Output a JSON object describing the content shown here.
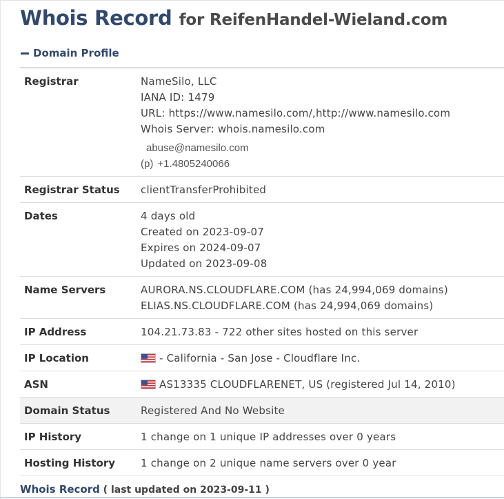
{
  "header": {
    "title_main": "Whois Record",
    "title_sub": "for ReifenHandel-Wieland.com"
  },
  "section": {
    "title": "Domain Profile",
    "icon": "minus-icon"
  },
  "registrar": {
    "label": "Registrar",
    "name": "NameSilo, LLC",
    "iana": "IANA ID: 1479",
    "url": "URL: https://www.namesilo.com/,http://www.namesilo.com",
    "whois_server": "Whois Server: whois.namesilo.com",
    "email": "abuse@namesilo.com",
    "phone_prefix": "(p)",
    "phone": "+1.4805240066"
  },
  "registrar_status": {
    "label": "Registrar Status",
    "value": "clientTransferProhibited"
  },
  "dates": {
    "label": "Dates",
    "age": "4 days old",
    "created": "Created on 2023-09-07",
    "expires": "Expires on 2024-09-07",
    "updated": "Updated on 2023-09-08"
  },
  "name_servers": {
    "label": "Name Servers",
    "ns1": "AURORA.NS.CLOUDFLARE.COM (has 24,994,069 domains)",
    "ns2": "ELIAS.NS.CLOUDFLARE.COM (has 24,994,069 domains)"
  },
  "ip_address": {
    "label": "IP Address",
    "value": "104.21.73.83 - 722 other sites hosted on this server"
  },
  "ip_location": {
    "label": "IP Location",
    "value": "- California - San Jose - Cloudflare Inc.",
    "flag_icon": "us-flag-icon"
  },
  "asn": {
    "label": "ASN",
    "value": "AS13335 CLOUDFLARENET, US (registered Jul 14, 2010)",
    "flag_icon": "us-flag-icon"
  },
  "domain_status": {
    "label": "Domain Status",
    "value": "Registered And No Website"
  },
  "ip_history": {
    "label": "IP History",
    "value": "1 change on 1 unique IP addresses over 0 years"
  },
  "hosting_history": {
    "label": "Hosting History",
    "value": "1 change on 2 unique name servers over 0 year"
  },
  "footer": {
    "title": "Whois Record",
    "note": "( last updated on 2023-09-11 )"
  },
  "colors": {
    "heading_blue": "#32496b",
    "shaded_row": "#f2f2f2"
  }
}
